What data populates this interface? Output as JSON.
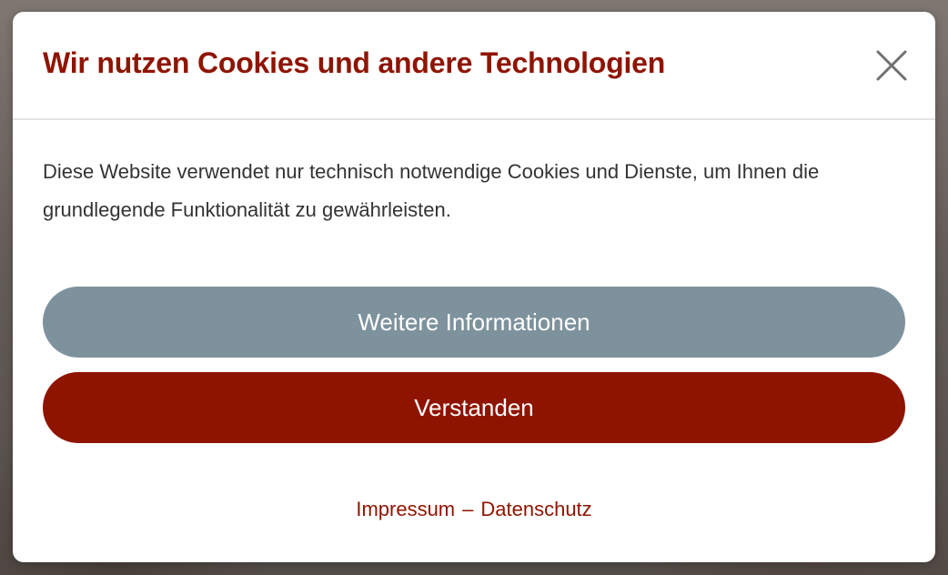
{
  "dialog": {
    "title": "Wir nutzen Cookies und andere Technologien",
    "close_icon": "close-icon",
    "body_text": "Diese Website verwendet nur technisch notwendige Cookies und Dienste, um Ihnen die grundlegende Funktionalität zu gewährleisten.",
    "more_info_label": "Weitere Informationen",
    "accept_label": "Verstanden",
    "footer": {
      "imprint_label": "Impressum",
      "separator": "–",
      "privacy_label": "Datenschutz"
    }
  },
  "colors": {
    "brand_red": "#8f1400",
    "info_button": "#7d929c",
    "body_text": "#333333",
    "close_icon": "#707070"
  }
}
